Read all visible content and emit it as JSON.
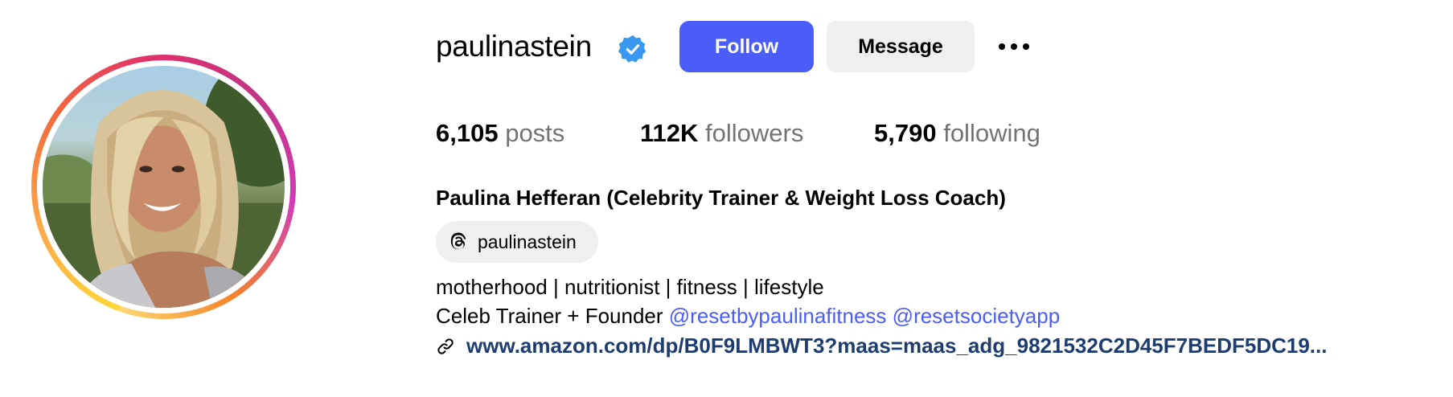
{
  "profile": {
    "username": "paulinastein",
    "verified": true,
    "avatar_alt": "profile-photo"
  },
  "actions": {
    "follow_label": "Follow",
    "message_label": "Message",
    "more_icon": "more-horizontal-icon"
  },
  "stats": {
    "posts_count": "6,105",
    "posts_label": "posts",
    "followers_count": "112K",
    "followers_label": "followers",
    "following_count": "5,790",
    "following_label": "following"
  },
  "bio": {
    "full_name": "Paulina Hefferan (Celebrity Trainer & Weight Loss Coach)",
    "threads_handle": "paulinastein",
    "line1": "motherhood | nutritionist | fitness | lifestyle",
    "line2_prefix": "Celeb Trainer + Founder",
    "mention1": "@resetbypaulinafitness",
    "mention2": "@resetsocietyapp",
    "link": "www.amazon.com/dp/B0F9LMBWT3?maas=maas_adg_9821532C2D45F7BEDF5DC19..."
  },
  "colors": {
    "accent": "#4a5df9",
    "verified": "#3897f0",
    "link": "#1d3c6f",
    "secondary_text": "#737373",
    "button_bg": "#efeff1"
  }
}
